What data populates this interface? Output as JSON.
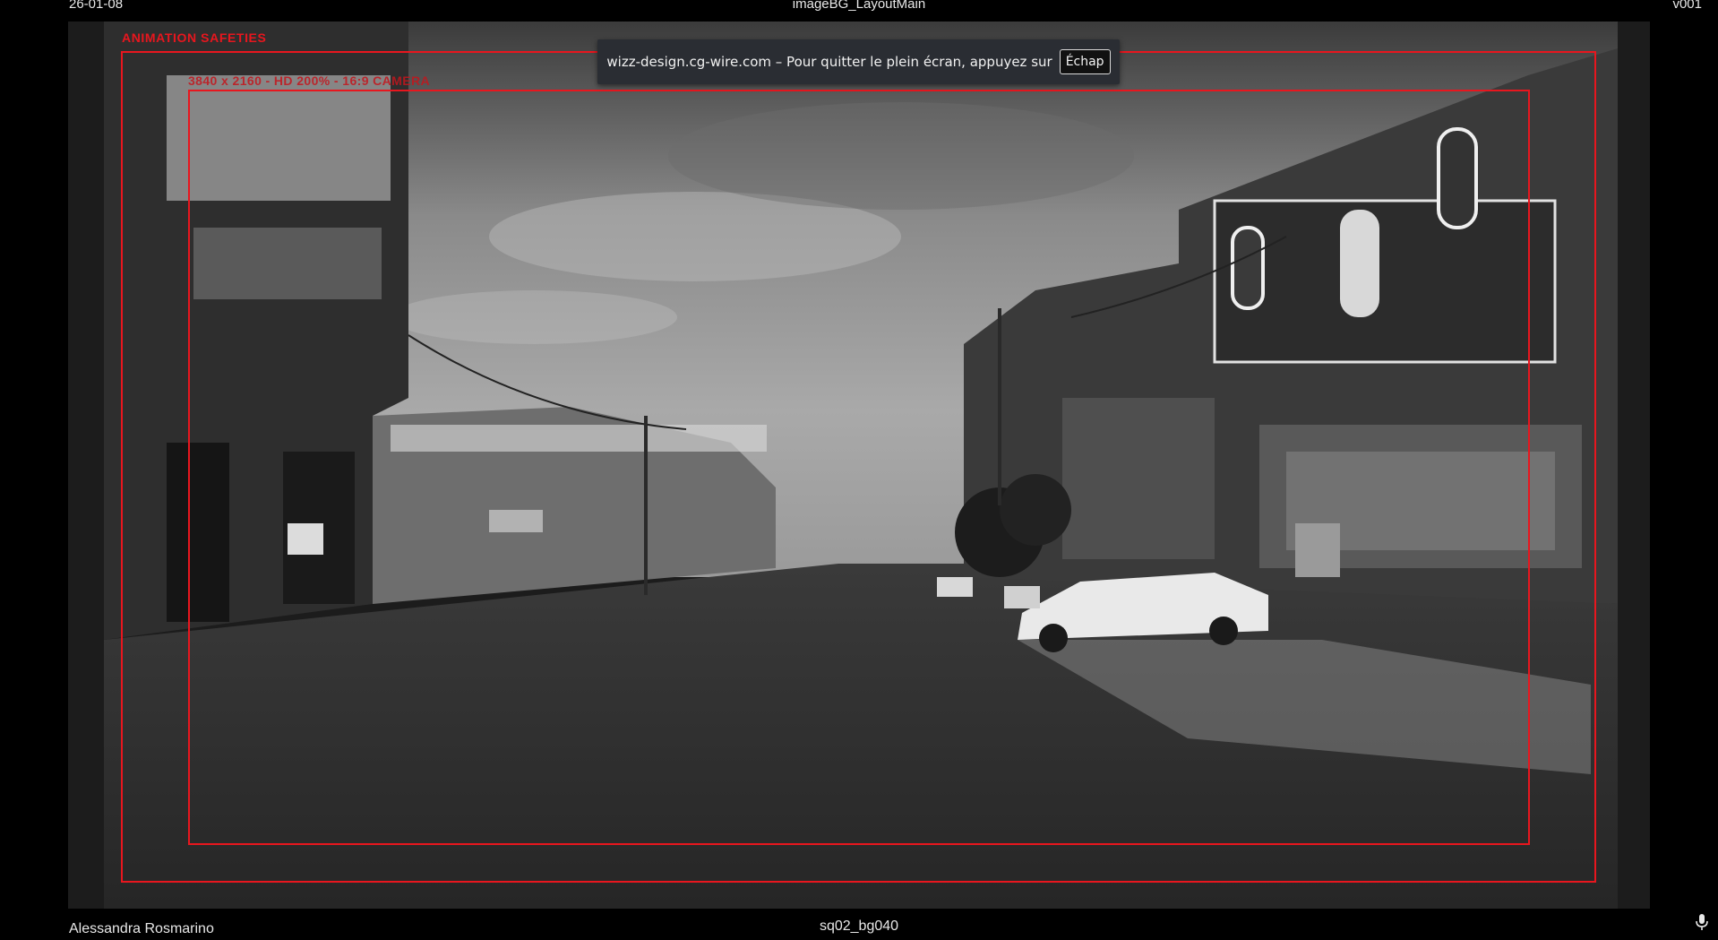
{
  "header": {
    "date": "26-01-08",
    "title": "imageBG_LayoutMain",
    "version": "v001"
  },
  "footer": {
    "author": "Alessandra Rosmarino",
    "shot": "sq02_bg040"
  },
  "overlay": {
    "safety_title": "ANIMATION SAFETIES",
    "camera_label": "3840 x 2160 - HD 200% - 16:9 CAMERA",
    "frame_color": "#e8161e"
  },
  "fullscreen_notice": {
    "message": "wizz-design.cg-wire.com – Pour quitter le plein écran, appuyez sur",
    "key": "Échap"
  },
  "icons": {
    "mic": "microphone-icon"
  }
}
